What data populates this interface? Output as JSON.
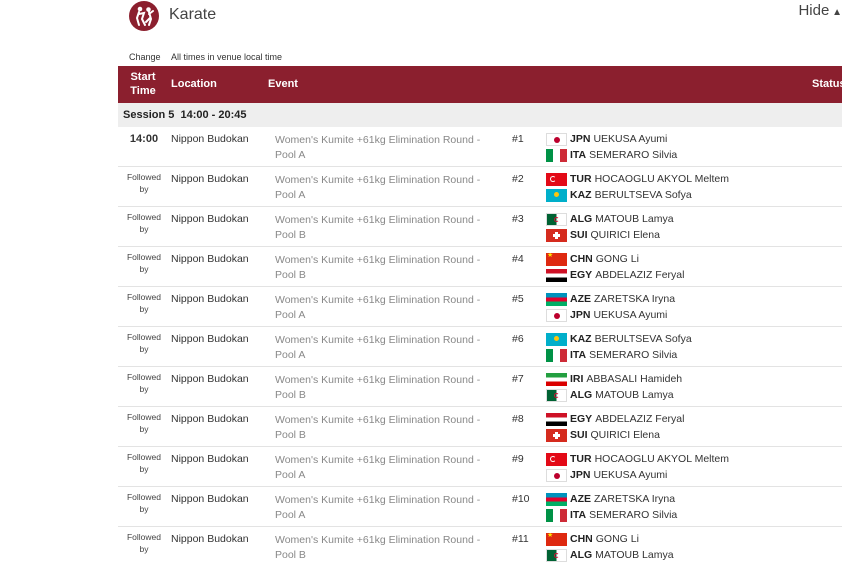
{
  "header": {
    "sport": "Karate",
    "hide_label": "Hide"
  },
  "subbar": {
    "change_label": "Change",
    "timezone_note": "All times in venue local time"
  },
  "table_header": {
    "start_time": "Start Time",
    "location": "Location",
    "event": "Event",
    "status": "Status"
  },
  "session": {
    "label": "Session 5  14:00 - 20:45"
  },
  "rows": [
    {
      "time": "14:00",
      "location": "Nippon Budokan",
      "event": "Women's Kumite +61kg Elimination Round - Pool A",
      "num": "#1",
      "a1": {
        "flag": "jpn",
        "noc": "JPN",
        "name": "UEKUSA Ayumi"
      },
      "a2": {
        "flag": "ita",
        "noc": "ITA",
        "name": "SEMERARO Silvia"
      }
    },
    {
      "time": "Followed by",
      "location": "Nippon Budokan",
      "event": "Women's Kumite +61kg Elimination Round - Pool A",
      "num": "#2",
      "a1": {
        "flag": "tur",
        "noc": "TUR",
        "name": "HOCAOGLU AKYOL Meltem"
      },
      "a2": {
        "flag": "kaz",
        "noc": "KAZ",
        "name": "BERULTSEVA Sofya"
      }
    },
    {
      "time": "Followed by",
      "location": "Nippon Budokan",
      "event": "Women's Kumite +61kg Elimination Round - Pool B",
      "num": "#3",
      "a1": {
        "flag": "alg",
        "noc": "ALG",
        "name": "MATOUB Lamya"
      },
      "a2": {
        "flag": "sui",
        "noc": "SUI",
        "name": "QUIRICI Elena"
      }
    },
    {
      "time": "Followed by",
      "location": "Nippon Budokan",
      "event": "Women's Kumite +61kg Elimination Round - Pool B",
      "num": "#4",
      "a1": {
        "flag": "chn",
        "noc": "CHN",
        "name": "GONG Li"
      },
      "a2": {
        "flag": "egy",
        "noc": "EGY",
        "name": "ABDELAZIZ Feryal"
      }
    },
    {
      "time": "Followed by",
      "location": "Nippon Budokan",
      "event": "Women's Kumite +61kg Elimination Round - Pool A",
      "num": "#5",
      "a1": {
        "flag": "aze",
        "noc": "AZE",
        "name": "ZARETSKA Iryna"
      },
      "a2": {
        "flag": "jpn",
        "noc": "JPN",
        "name": "UEKUSA Ayumi"
      }
    },
    {
      "time": "Followed by",
      "location": "Nippon Budokan",
      "event": "Women's Kumite +61kg Elimination Round - Pool A",
      "num": "#6",
      "a1": {
        "flag": "kaz",
        "noc": "KAZ",
        "name": "BERULTSEVA Sofya"
      },
      "a2": {
        "flag": "ita",
        "noc": "ITA",
        "name": "SEMERARO Silvia"
      }
    },
    {
      "time": "Followed by",
      "location": "Nippon Budokan",
      "event": "Women's Kumite +61kg Elimination Round - Pool B",
      "num": "#7",
      "a1": {
        "flag": "iri",
        "noc": "IRI",
        "name": "ABBASALI Hamideh"
      },
      "a2": {
        "flag": "alg",
        "noc": "ALG",
        "name": "MATOUB Lamya"
      }
    },
    {
      "time": "Followed by",
      "location": "Nippon Budokan",
      "event": "Women's Kumite +61kg Elimination Round - Pool B",
      "num": "#8",
      "a1": {
        "flag": "egy",
        "noc": "EGY",
        "name": "ABDELAZIZ Feryal"
      },
      "a2": {
        "flag": "sui",
        "noc": "SUI",
        "name": "QUIRICI Elena"
      }
    },
    {
      "time": "Followed by",
      "location": "Nippon Budokan",
      "event": "Women's Kumite +61kg Elimination Round - Pool A",
      "num": "#9",
      "a1": {
        "flag": "tur",
        "noc": "TUR",
        "name": "HOCAOGLU AKYOL Meltem"
      },
      "a2": {
        "flag": "jpn",
        "noc": "JPN",
        "name": "UEKUSA Ayumi"
      }
    },
    {
      "time": "Followed by",
      "location": "Nippon Budokan",
      "event": "Women's Kumite +61kg Elimination Round - Pool A",
      "num": "#10",
      "a1": {
        "flag": "aze",
        "noc": "AZE",
        "name": "ZARETSKA Iryna"
      },
      "a2": {
        "flag": "ita",
        "noc": "ITA",
        "name": "SEMERARO Silvia"
      }
    },
    {
      "time": "Followed by",
      "location": "Nippon Budokan",
      "event": "Women's Kumite +61kg Elimination Round - Pool B",
      "num": "#11",
      "a1": {
        "flag": "chn",
        "noc": "CHN",
        "name": "GONG Li"
      },
      "a2": {
        "flag": "alg",
        "noc": "ALG",
        "name": "MATOUB Lamya"
      }
    }
  ],
  "colors": {
    "header_bg": "#8b1f2e",
    "session_bg": "#eeeeee"
  },
  "icons": {
    "sport_logo": "karate-pictogram-icon",
    "hide_chevron": "chevron-up-icon"
  }
}
